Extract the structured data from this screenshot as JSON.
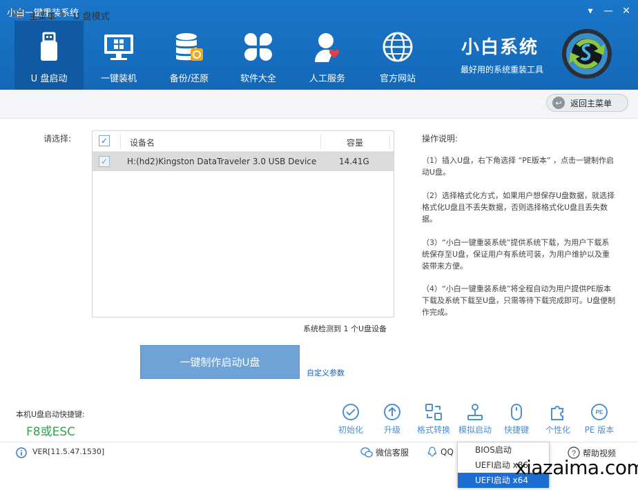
{
  "window": {
    "title": "小白一键重装系统",
    "controls": [
      "▾",
      "—",
      "✕"
    ]
  },
  "nav": [
    {
      "label": "U 盘启动",
      "icon": "usb-drive-icon",
      "active": true
    },
    {
      "label": "一键装机",
      "icon": "monitor-windows-icon"
    },
    {
      "label": "备份/还原",
      "icon": "database-backup-icon"
    },
    {
      "label": "软件大全",
      "icon": "clover-apps-icon"
    },
    {
      "label": "人工服务",
      "icon": "person-heart-icon"
    },
    {
      "label": "官方网站",
      "icon": "globe-icon"
    }
  ],
  "brand": {
    "name": "小白系统",
    "slogan": "最好用的系统重装工具"
  },
  "breadcrumb": {
    "main": "主菜单",
    "separator": "▶",
    "current": "U 盘模式",
    "back_label": "返回主菜单"
  },
  "device_select": {
    "label": "请选择:",
    "columns": [
      "设备名",
      "容量"
    ],
    "rows": [
      {
        "name": "H:(hd2)Kingston DataTraveler 3.0 USB Device",
        "size": "14.41G",
        "checked": true
      }
    ],
    "detected": "系统检测到 1 个U盘设备"
  },
  "actions": {
    "make_label": "一键制作启动U盘",
    "custom_label": "自定义参数"
  },
  "help": {
    "title": "操作说明:",
    "paragraphs": [
      "（1）插入U盘，右下角选择 “PE版本” ，点击一键制作启动U盘。",
      "（2）选择格式化方式，如果用户想保存U盘数据，就选择格式化U盘且不丢失数据，否则选择格式化U盘且丢失数据。",
      "（3）“小白一键重装系统”提供系统下载，为用户下载系统保存至U盘，保证用户有系统可装，为用户维护以及重装带来方便。",
      "（4）“小白一键重装系统”将全程自动为用户提供PE版本下载及系统下载至U盘，只需等待下载完成即可。U盘便制作完成。"
    ]
  },
  "hotkey": {
    "label": "本机U盘启动快捷键:",
    "value": "F8或ESC"
  },
  "tools": [
    {
      "label": "初始化",
      "icon": "check-circle-icon"
    },
    {
      "label": "升级",
      "icon": "arrow-up-circle-icon"
    },
    {
      "label": "格式转换",
      "icon": "convert-icon"
    },
    {
      "label": "模拟启动",
      "icon": "joystick-icon"
    },
    {
      "label": "快捷键",
      "icon": "mouse-icon"
    },
    {
      "label": "个性化",
      "icon": "puzzle-icon"
    },
    {
      "label": "PE 版本",
      "icon": "pe-badge-icon"
    }
  ],
  "status": {
    "version": "VER[11.5.47.1530]",
    "wechat": "微信客服",
    "qq": "QQ",
    "help_video": "帮助视频"
  },
  "boot_menu": {
    "items": [
      "BIOS启动",
      "UEFI启动 x86",
      "UEFI启动 x64"
    ],
    "selected": 2
  },
  "watermark": "xiazaima.com",
  "colors": {
    "header": "#1a76c9",
    "active_tab": "#0f5aa3",
    "accent": "#4a8fd4",
    "hotkey": "#2ea44f",
    "selection": "#1e6ed1"
  }
}
